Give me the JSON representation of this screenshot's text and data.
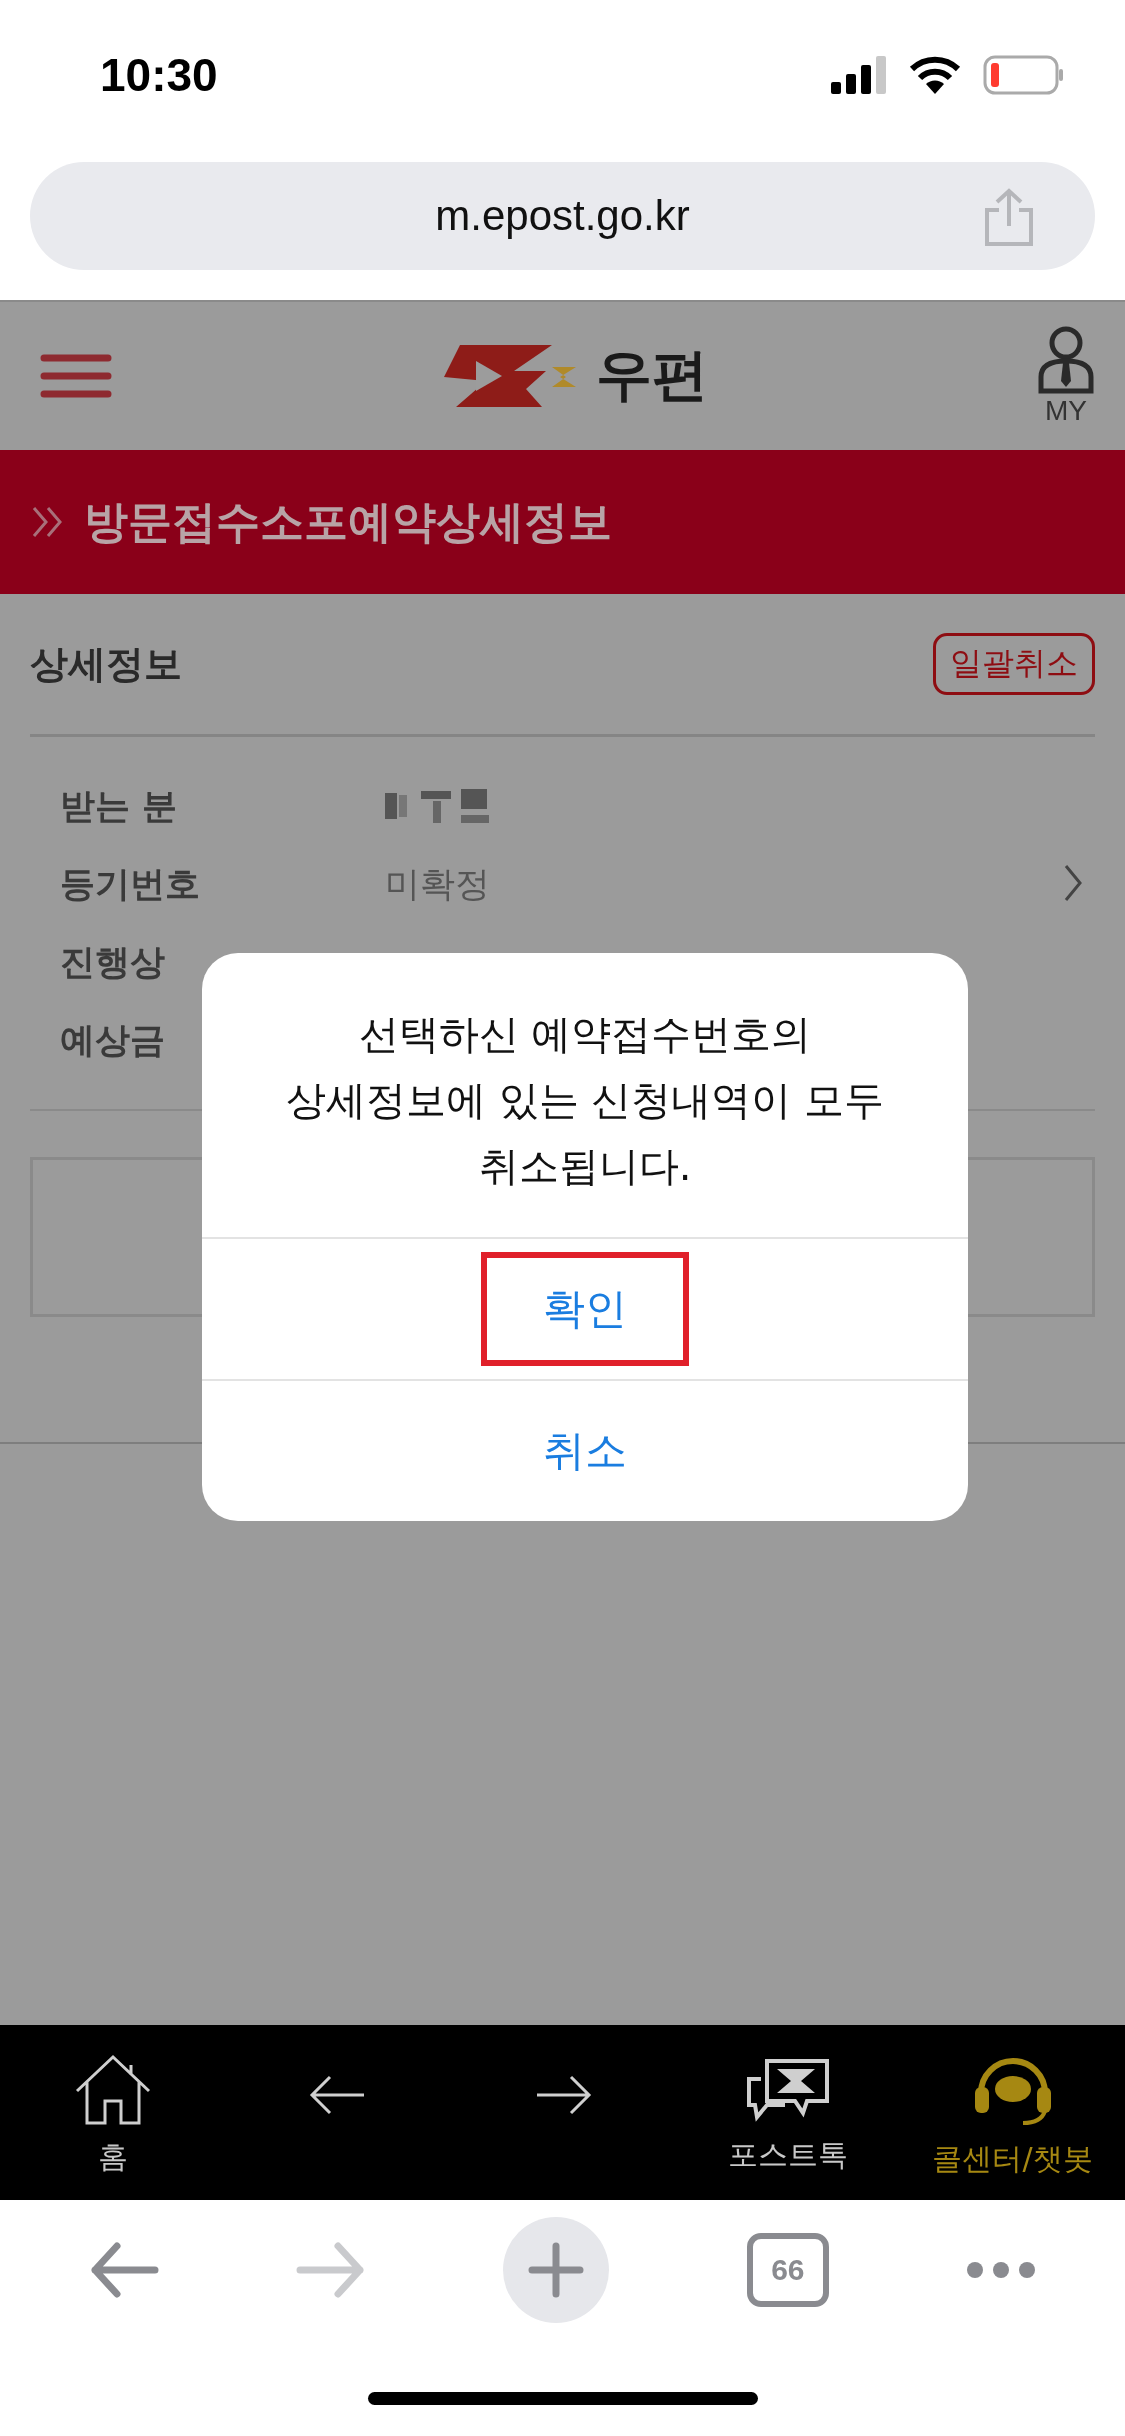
{
  "status_bar": {
    "time": "10:30"
  },
  "address_bar": {
    "url": "m.epost.go.kr"
  },
  "header": {
    "logo_text": "우편",
    "my_label": "MY"
  },
  "banner": {
    "title": "방문접수소포예약상세정보"
  },
  "section": {
    "title": "상세정보",
    "action": "일괄취소"
  },
  "details": [
    {
      "kind": "redacted",
      "label": "받는 분"
    },
    {
      "kind": "text",
      "label": "등기번호",
      "value": "미확정"
    },
    {
      "kind": "hidden",
      "label": "진행상"
    },
    {
      "kind": "hidden",
      "label": "예상금"
    }
  ],
  "dialog": {
    "message": "선택하신 예약접수번호의\n상세정보에 있는 신청내역이 모두\n취소됩니다.",
    "buttons": [
      {
        "label": "확인",
        "highlighted": true
      },
      {
        "label": "취소",
        "highlighted": false
      }
    ]
  },
  "bottom_nav": [
    {
      "kind": "home",
      "label": "홈"
    },
    {
      "kind": "back"
    },
    {
      "kind": "forward"
    },
    {
      "kind": "posttalk",
      "label": "포스트톡"
    },
    {
      "kind": "callcenter",
      "label": "콜센터/챗봇"
    }
  ],
  "browser_toolbar": [
    {
      "kind": "back",
      "disabled": false
    },
    {
      "kind": "forward",
      "disabled": true
    },
    {
      "kind": "new_tab",
      "disabled": false
    },
    {
      "kind": "tabs",
      "label": "66",
      "disabled": false
    },
    {
      "kind": "more",
      "disabled": false
    }
  ]
}
